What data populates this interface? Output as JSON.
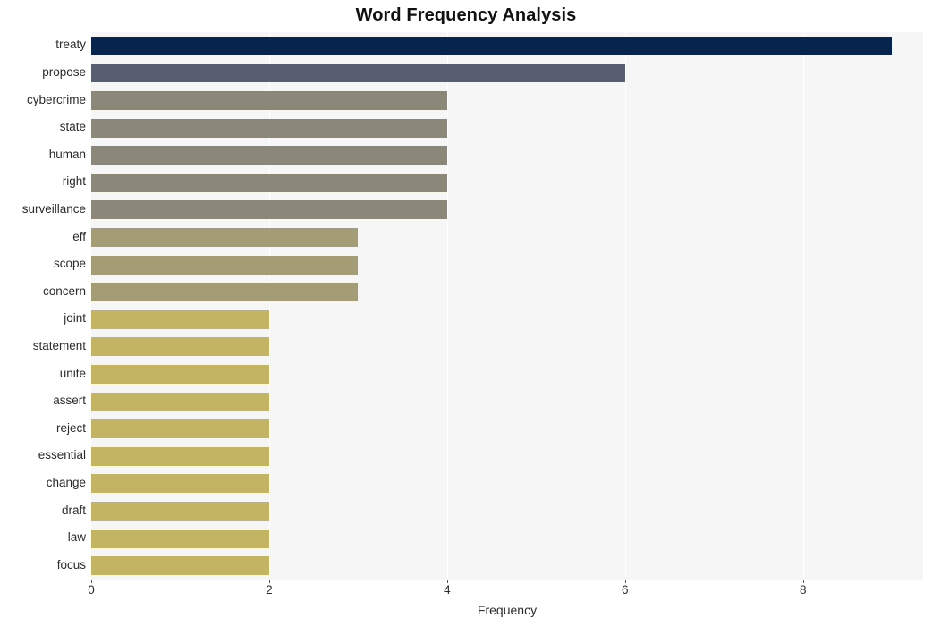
{
  "chart_data": {
    "type": "bar",
    "orientation": "horizontal",
    "title": "Word Frequency Analysis",
    "xlabel": "Frequency",
    "ylabel": "",
    "categories": [
      "treaty",
      "propose",
      "cybercrime",
      "state",
      "human",
      "right",
      "surveillance",
      "eff",
      "scope",
      "concern",
      "joint",
      "statement",
      "unite",
      "assert",
      "reject",
      "essential",
      "change",
      "draft",
      "law",
      "focus"
    ],
    "values": [
      9,
      6,
      4,
      4,
      4,
      4,
      4,
      3,
      3,
      3,
      2,
      2,
      2,
      2,
      2,
      2,
      2,
      2,
      2,
      2
    ],
    "bar_colors": [
      "#07244c",
      "#575e6f",
      "#8b8879",
      "#8b8879",
      "#8b8879",
      "#8b8879",
      "#8b8879",
      "#a49c74",
      "#a49c74",
      "#a49c74",
      "#c3b464",
      "#c3b464",
      "#c3b464",
      "#c3b464",
      "#c3b464",
      "#c3b464",
      "#c3b464",
      "#c3b464",
      "#c3b464",
      "#c3b464"
    ],
    "xlim": [
      0,
      9.35
    ],
    "xticks": [
      0,
      2,
      4,
      6,
      8
    ],
    "xticklabels": [
      "0",
      "2",
      "4",
      "6",
      "8"
    ],
    "grid": true,
    "grid_color": "#ffffff",
    "plot_background": "#f6f6f7",
    "figure_background": "#ffffff",
    "legend": null
  }
}
